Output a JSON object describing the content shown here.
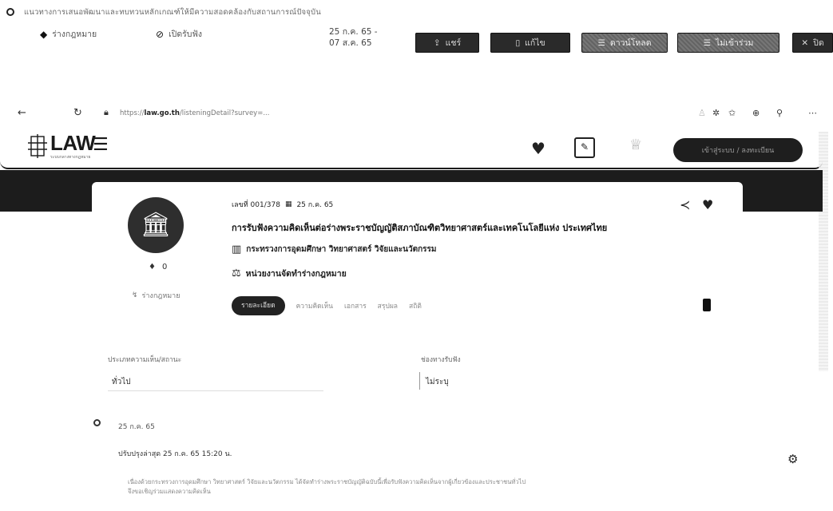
{
  "top": {
    "title": "แนวทางการเสนอพัฒนาและทบทวนหลักเกณฑ์ให้มีความสอดคล้องกับสถานการณ์ปัจจุบัน",
    "meta_left": "ร่างกฎหมาย",
    "meta_status": "เปิดรับฟัง",
    "date_line1": "25 ก.ค. 65 -",
    "date_line2": "07 ส.ค. 65",
    "buttons": [
      {
        "label": "แชร์",
        "icon": "share-icon"
      },
      {
        "label": "แก้ไข",
        "icon": "edit-icon"
      },
      {
        "label": "ดาวน์โหลด",
        "icon": "download-icon"
      },
      {
        "label": "ไม่เข้าร่วม",
        "icon": "exclude-icon"
      },
      {
        "label": "ปิด",
        "icon": "close-icon"
      }
    ]
  },
  "browser": {
    "url_host": "law.go.th",
    "url_path": "/listeningDetail?survey=..."
  },
  "header": {
    "logo_text": "LAW",
    "logo_sub": "ระบบกลางทางกฎหมาย",
    "login_label": "เข้าสู่ระบบ / ลงทะเบียน"
  },
  "doc": {
    "number": "เลขที่ 001/378",
    "date": "25 ก.ค. 65",
    "title": "การรับฟังความคิดเห็นต่อร่างพระราชบัญญัติสภาบัณฑิตวิทยาศาสตร์และเทคโนโลยีแห่ง ประเทศไทย",
    "agency": "กระทรวงการอุดมศึกษา วิทยาศาสตร์ วิจัยและนวัตกรรม",
    "unit": "หน่วยงานจัดทำร่างกฎหมาย",
    "like_count": "0",
    "share_label": "ร่างกฎหมาย"
  },
  "tabs": [
    "รายละเอียด",
    "ความคิดเห็น",
    "เอกสาร",
    "สรุปผล",
    "สถิติ"
  ],
  "fields": {
    "left_label": "ประเภทความเห็น/สถานะ",
    "left_value": "ทั่วไป",
    "right_label": "ช่องทางรับฟัง",
    "right_value": "ไม่ระบุ"
  },
  "timeline": {
    "date": "25 ก.ค. 65",
    "updated": "ปรับปรุงล่าสุด 25 ก.ค. 65 15:20 น.",
    "desc_line1": "เนื่องด้วยกระทรวงการอุดมศึกษา วิทยาศาสตร์ วิจัยและนวัตกรรม ได้จัดทำร่างพระราชบัญญัติฉบับนี้เพื่อรับฟังความคิดเห็นจากผู้เกี่ยวข้องและประชาชนทั่วไป",
    "desc_line2": "จึงขอเชิญร่วมแสดงความคิดเห็น"
  }
}
